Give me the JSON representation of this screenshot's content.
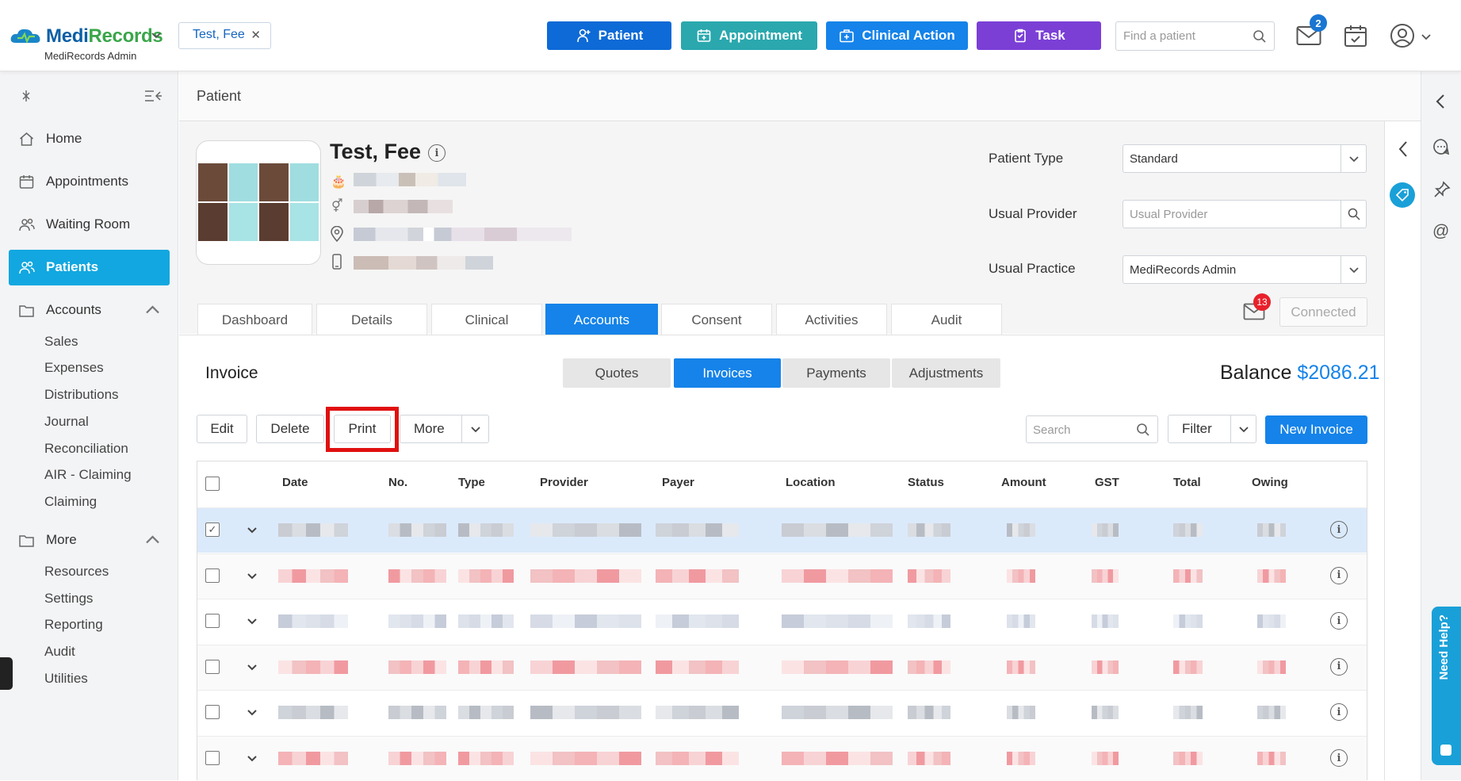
{
  "header": {
    "logo_text_1": "Medi",
    "logo_text_2": "Records",
    "logo_sub": "MediRecords Admin",
    "patient_chip": "Test, Fee",
    "buttons": {
      "patient": "Patient",
      "appointment": "Appointment",
      "clinical_action": "Clinical Action",
      "task": "Task"
    },
    "find_placeholder": "Find a patient",
    "mail_badge": "2",
    "colors": {
      "patient": "#0d6ad6",
      "appointment": "#2aa8ae",
      "clinical_action": "#1583e9",
      "task": "#7b3fd6"
    }
  },
  "sidebar": {
    "items": [
      {
        "label": "Home",
        "icon": "home-icon"
      },
      {
        "label": "Appointments",
        "icon": "calendar-icon"
      },
      {
        "label": "Waiting Room",
        "icon": "people-icon"
      },
      {
        "label": "Patients",
        "icon": "patients-icon",
        "active": true
      },
      {
        "label": "Accounts",
        "icon": "folder-icon",
        "expanded": true
      },
      {
        "label": "More",
        "icon": "folder-icon",
        "expanded": true
      }
    ],
    "accounts_sub": [
      "Sales",
      "Expenses",
      "Distributions",
      "Journal",
      "Reconciliation",
      "AIR - Claiming",
      "Claiming"
    ],
    "more_sub": [
      "Resources",
      "Settings",
      "Reporting",
      "Audit",
      "Utilities"
    ]
  },
  "page": {
    "title": "Patient",
    "patient_name": "Test, Fee",
    "fields": {
      "patient_type_label": "Patient Type",
      "patient_type_value": "Standard",
      "usual_provider_label": "Usual Provider",
      "usual_provider_placeholder": "Usual Provider",
      "usual_practice_label": "Usual Practice",
      "usual_practice_value": "MediRecords Admin"
    },
    "message_badge": "13",
    "connected_label": "Connected",
    "tabs": [
      "Dashboard",
      "Details",
      "Clinical",
      "Accounts",
      "Consent",
      "Activities",
      "Audit"
    ],
    "active_tab": "Accounts"
  },
  "invoice": {
    "heading": "Invoice",
    "segments": [
      "Quotes",
      "Invoices",
      "Payments",
      "Adjustments"
    ],
    "active_segment": "Invoices",
    "balance_label": "Balance",
    "balance_value": "$2086.21",
    "actions": {
      "edit": "Edit",
      "delete": "Delete",
      "print": "Print",
      "more": "More"
    },
    "search_placeholder": "Search",
    "filter_label": "Filter",
    "new_invoice_label": "New Invoice",
    "columns": [
      "Date",
      "No.",
      "Type",
      "Provider",
      "Payer",
      "Location",
      "Status",
      "Amount",
      "GST",
      "Total",
      "Owing"
    ],
    "rows": [
      {
        "checked": true,
        "selected": true,
        "tint": "gray"
      },
      {
        "checked": false,
        "tint": "red"
      },
      {
        "checked": false,
        "tint": "mixed"
      },
      {
        "checked": false,
        "tint": "red"
      },
      {
        "checked": false,
        "tint": "gray"
      },
      {
        "checked": false,
        "tint": "red"
      }
    ]
  },
  "right_rail": {
    "need_help": "Need Help?"
  }
}
